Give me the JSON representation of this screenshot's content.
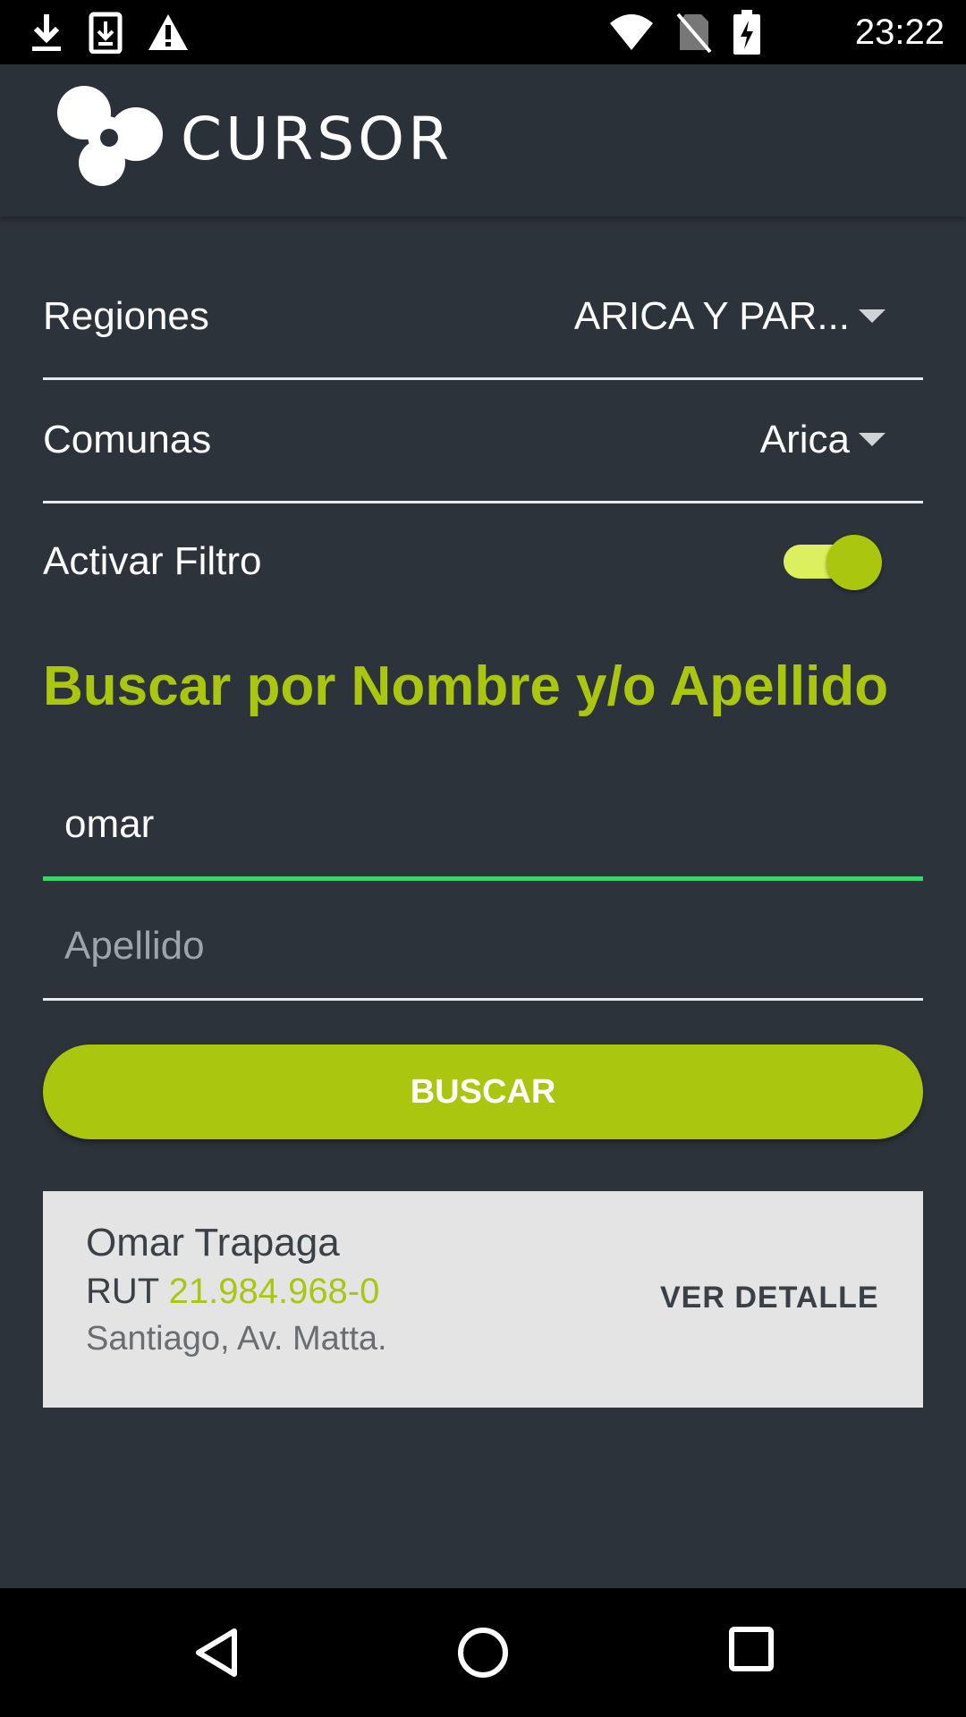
{
  "status_bar": {
    "time": "23:22",
    "left_icons": [
      "download-icon",
      "download-file-icon",
      "warning-icon"
    ],
    "right_icons": [
      "wifi-icon",
      "no-sim-icon",
      "battery-charging-icon"
    ]
  },
  "app_bar": {
    "logo_text": "CURSOR"
  },
  "filters": {
    "regiones_label": "Regiones",
    "regiones_value": "ARICA Y PAR...",
    "comunas_label": "Comunas",
    "comunas_value": "Arica",
    "filtro_label": "Activar Filtro",
    "filtro_on": true
  },
  "search": {
    "title": "Buscar por Nombre y/o Apellido",
    "name_value": "omar",
    "lastname_placeholder": "Apellido",
    "button_label": "BUSCAR"
  },
  "results": [
    {
      "name": "Omar Trapaga",
      "rut_label": "RUT ",
      "rut": "21.984.968-0",
      "address": "Santiago, Av. Matta.",
      "action": "VER DETALLE"
    }
  ],
  "colors": {
    "accent": "#abc60e",
    "background": "#2d333b",
    "focus_line": "#38d36a"
  },
  "nav_bar": {
    "icons": [
      "back-icon",
      "home-icon",
      "recents-icon"
    ]
  }
}
